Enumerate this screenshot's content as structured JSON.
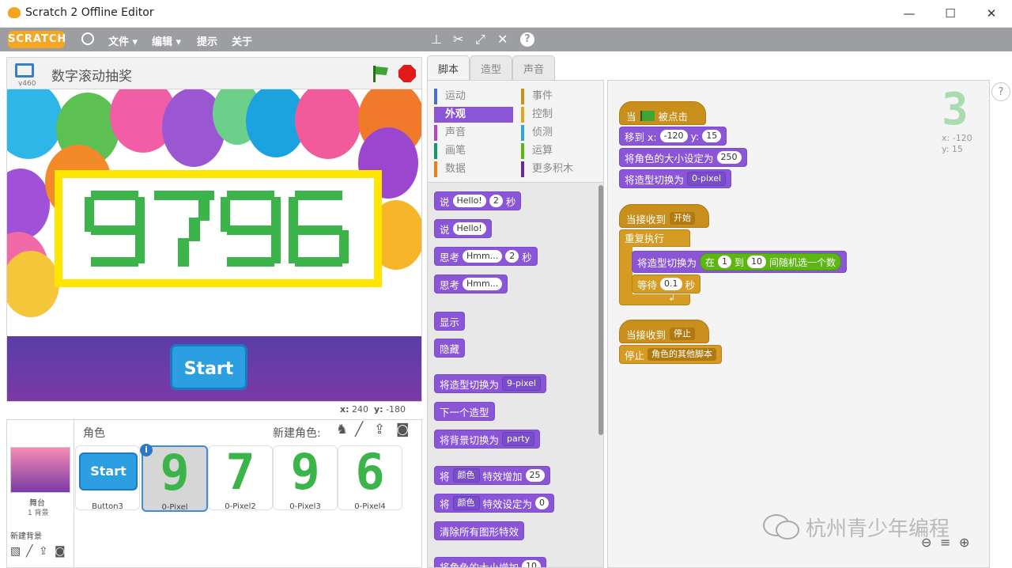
{
  "window": {
    "title": "Scratch 2 Offline Editor",
    "minimize": "—",
    "maximize": "☐",
    "close": "✕"
  },
  "menubar": {
    "logo": "SCRATCH",
    "items": [
      "文件",
      "编辑",
      "提示",
      "关于"
    ],
    "menu_arrow": "▾"
  },
  "stage": {
    "version": "v460",
    "project_title": "数字滚动抽奖",
    "display_number": "9796",
    "start_button": "Start",
    "coords_x_label": "x:",
    "coords_x": "240",
    "coords_y_label": "y:",
    "coords_y": "-180"
  },
  "sprites": {
    "header_label": "角色",
    "new_sprite_label": "新建角色:",
    "stage_label": "舞台",
    "stage_backdrops": "1 背景",
    "new_backdrop_label": "新建背景",
    "items": [
      {
        "name": "Button3",
        "digit": ""
      },
      {
        "name": "0-Pixel",
        "digit": "9"
      },
      {
        "name": "0-Pixel2",
        "digit": "7"
      },
      {
        "name": "0-Pixel3",
        "digit": "9"
      },
      {
        "name": "0-Pixel4",
        "digit": "6"
      }
    ],
    "button_thumb_text": "Start",
    "info_badge": "i"
  },
  "tabs": [
    "脚本",
    "造型",
    "声音"
  ],
  "categories": {
    "left": [
      "运动",
      "外观",
      "声音",
      "画笔",
      "数据"
    ],
    "right": [
      "事件",
      "控制",
      "侦测",
      "运算",
      "更多积木"
    ],
    "colors_left": [
      "#4a6cd4",
      "#8a55d7",
      "#bb42c3",
      "#0e9a6c",
      "#ee7d16"
    ],
    "colors_right": [
      "#c88f1c",
      "#e1a91a",
      "#2ca5e2",
      "#5cb712",
      "#632d99"
    ]
  },
  "palette": {
    "say_secs": {
      "label": "说",
      "text": "Hello!",
      "secs": "2",
      "unit": "秒"
    },
    "say": {
      "label": "说",
      "text": "Hello!"
    },
    "think_secs": {
      "label": "思考",
      "text": "Hmm...",
      "secs": "2",
      "unit": "秒"
    },
    "think": {
      "label": "思考",
      "text": "Hmm..."
    },
    "show": "显示",
    "hide": "隐藏",
    "switch_costume": {
      "label": "将造型切换为",
      "value": "9-pixel"
    },
    "next_costume": "下一个造型",
    "switch_backdrop": {
      "label": "将背景切换为",
      "value": "party"
    },
    "change_effect": {
      "label": "将",
      "effect": "颜色",
      "mid": "特效增加",
      "value": "25"
    },
    "set_effect": {
      "label": "将",
      "effect": "颜色",
      "mid": "特效设定为",
      "value": "0"
    },
    "clear_effects": "清除所有图形特效",
    "change_size": {
      "label": "将角色的大小增加",
      "value": "10"
    }
  },
  "scripts": {
    "when_flag": {
      "prefix": "当",
      "suffix": "被点击"
    },
    "goto": {
      "label": "移到 x:",
      "x": "-120",
      "ylabel": "y:",
      "y": "15"
    },
    "set_size": {
      "label": "将角色的大小设定为",
      "value": "250"
    },
    "switch_costume": {
      "label": "将造型切换为",
      "value": "0-pixel"
    },
    "receive_start": {
      "label": "当接收到",
      "value": "开始"
    },
    "forever": "重复执行",
    "switch_random": {
      "label": "将造型切换为",
      "in": "在",
      "from": "1",
      "to_label": "到",
      "to": "10",
      "tail": "间随机选一个数"
    },
    "wait": {
      "label": "等待",
      "value": "0.1",
      "unit": "秒"
    },
    "receive_stop": {
      "label": "当接收到",
      "value": "停止"
    },
    "stop": {
      "label": "停止",
      "value": "角色的其他脚本"
    },
    "sprite_info": {
      "digit": "3",
      "x_label": "x:",
      "x": "-120",
      "y_label": "y:",
      "y": "15"
    },
    "help": "?",
    "watermark": "杭州青少年编程"
  },
  "colors": {
    "looks": "#8a55d7",
    "events": "#c88f1c",
    "control": "#d69b22",
    "operators": "#5cb712",
    "digit_green": "#3bb54a",
    "frame_yellow": "#ffe600"
  }
}
